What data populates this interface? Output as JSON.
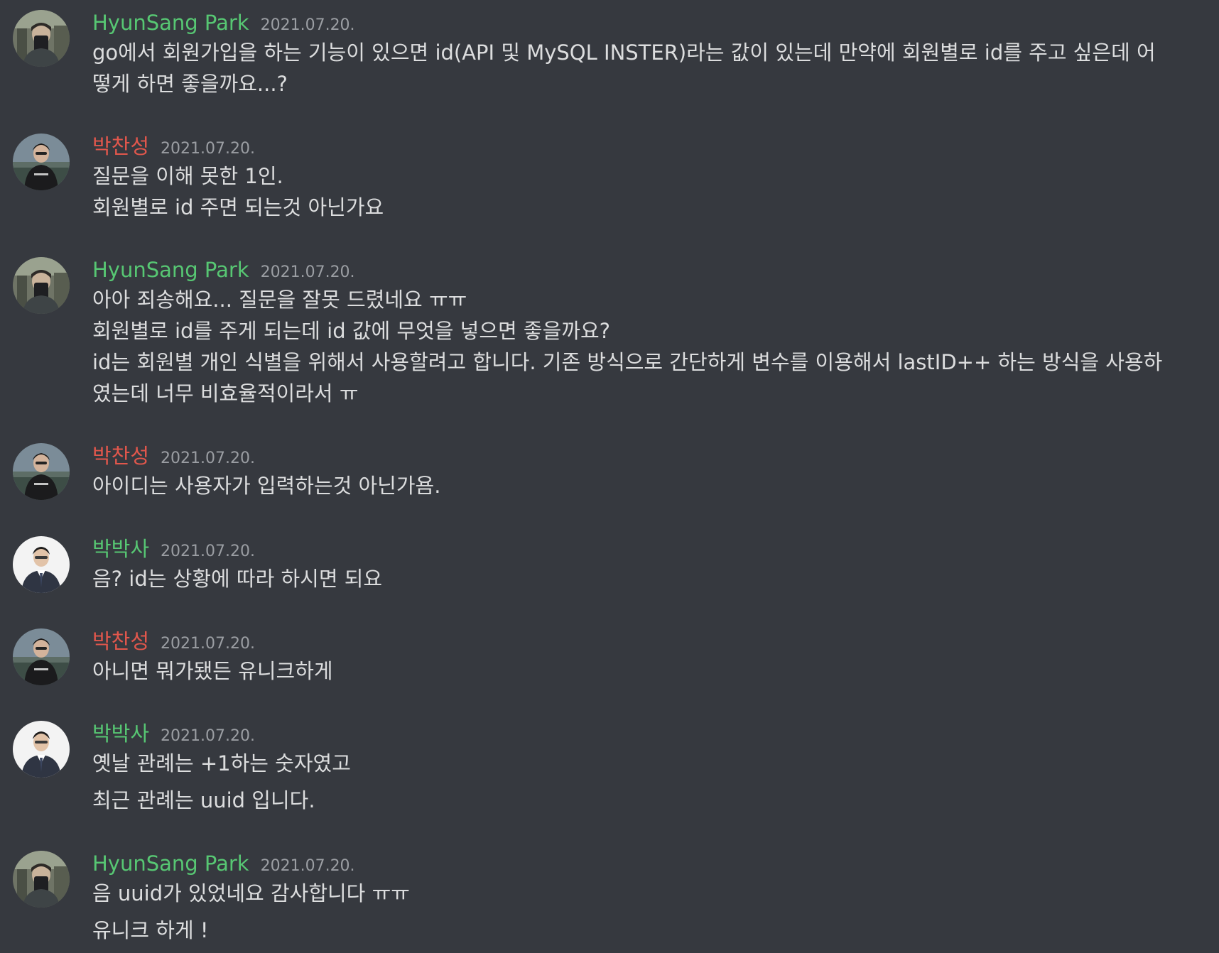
{
  "colors": {
    "background": "#36393f",
    "text": "#dcddde",
    "timestamp": "#9b9ea3",
    "author_green": "#57c773",
    "author_red": "#e2574c"
  },
  "messages": [
    {
      "author": "HyunSang Park",
      "timestamp": "2021.07.20.",
      "lines": [
        "go에서 회원가입을 하는 기능이 있으면 id(API 및 MySQL INSTER)라는 값이 있는데 만약에 회원별로 id를 주고 싶은데 어",
        "떻게 하면 좋을까요...?"
      ]
    },
    {
      "author": "박찬성",
      "timestamp": "2021.07.20.",
      "lines": [
        "질문을 이해 못한 1인.",
        "회원별로 id 주면 되는것 아닌가요"
      ]
    },
    {
      "author": "HyunSang Park",
      "timestamp": "2021.07.20.",
      "lines": [
        "아아 죄송해요... 질문을 잘못 드렸네요 ㅠㅠ",
        "회원별로 id를 주게 되는데 id 값에 무엇을 넣으면 좋을까요?",
        "id는 회원별 개인 식별을 위해서 사용할려고 합니다. 기존 방식으로 간단하게 변수를 이용해서 lastID++ 하는 방식을 사용하",
        "였는데 너무 비효율적이라서 ㅠ"
      ]
    },
    {
      "author": "박찬성",
      "timestamp": "2021.07.20.",
      "lines": [
        "아이디는 사용자가 입력하는것 아닌가욤."
      ]
    },
    {
      "author": "박박사",
      "timestamp": "2021.07.20.",
      "lines": [
        "음? id는 상황에 따라 하시면 되요"
      ]
    },
    {
      "author": "박찬성",
      "timestamp": "2021.07.20.",
      "lines": [
        "아니면 뭐가됐든 유니크하게"
      ]
    },
    {
      "author": "박박사",
      "timestamp": "2021.07.20.",
      "lines": [
        "옛날 관례는 +1하는 숫자였고",
        "최근 관례는  uuid 입니다."
      ]
    },
    {
      "author": "HyunSang Park",
      "timestamp": "2021.07.20.",
      "lines": [
        "음 uuid가 있었네요 감사합니다 ㅠㅠ",
        "유니크 하게 !"
      ]
    }
  ]
}
